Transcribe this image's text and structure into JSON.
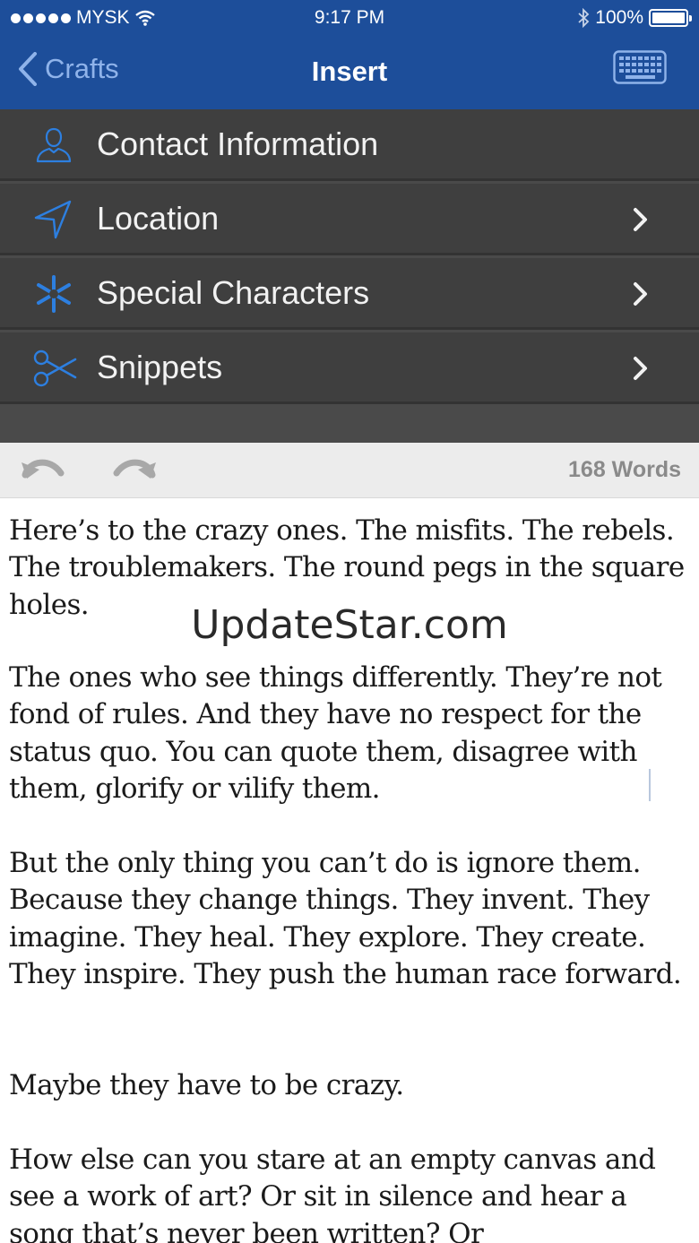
{
  "status_bar": {
    "carrier": "MYSK",
    "time": "9:17 PM",
    "battery": "100%"
  },
  "nav": {
    "back_label": "Crafts",
    "title": "Insert"
  },
  "menu": {
    "items": [
      {
        "label": "Contact Information",
        "icon": "person-icon"
      },
      {
        "label": "Location",
        "icon": "location-arrow-icon"
      },
      {
        "label": "Special Characters",
        "icon": "asterisk-icon"
      },
      {
        "label": "Snippets",
        "icon": "scissors-icon"
      }
    ]
  },
  "toolbar": {
    "word_count": "168 Words"
  },
  "editor": {
    "paragraphs": [
      "Here’s to the crazy ones. The misfits. The rebels. The troublemakers. The round pegs in the square holes.",
      "The ones who see things differently. They’re not fond of rules. And they have no respect for the status quo. You can quote them, disagree with them, glorify or vilify them.",
      "But the only thing you can’t do is ignore them. Because they change things. They invent. They imagine. They heal. They explore. They create. They inspire. They push the human race forward.",
      "Maybe they have to be crazy.",
      "How else can you stare at an empty canvas and see a work of art? Or sit in silence and hear a song that’s never been written? Or"
    ]
  },
  "watermark": "UpdateStar.com",
  "colors": {
    "nav_bg": "#1d4e9a",
    "menu_bg": "#3f3f3f",
    "icon_blue": "#2d7fe0"
  }
}
